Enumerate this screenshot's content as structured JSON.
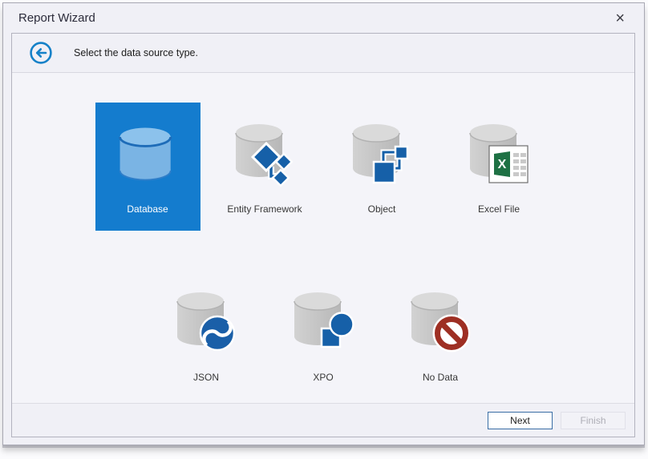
{
  "window": {
    "title": "Report Wizard",
    "close_glyph": "×"
  },
  "header": {
    "instruction": "Select the data source type."
  },
  "tiles": {
    "row1": [
      {
        "label": "Database",
        "icon": "database-cylinder",
        "selected": true
      },
      {
        "label": "Entity Framework",
        "icon": "entity-framework",
        "selected": false
      },
      {
        "label": "Object",
        "icon": "object",
        "selected": false
      },
      {
        "label": "Excel File",
        "icon": "excel-file",
        "selected": false
      }
    ],
    "row2": [
      {
        "label": "JSON",
        "icon": "json-swirl",
        "selected": false
      },
      {
        "label": "XPO",
        "icon": "xpo",
        "selected": false
      },
      {
        "label": "No Data",
        "icon": "no-data",
        "selected": false
      }
    ]
  },
  "footer": {
    "next_label": "Next",
    "finish_label": "Finish",
    "finish_enabled": false
  },
  "colors": {
    "selection_blue": "#147cce",
    "accent_blue": "#1660a8",
    "cylinder_gray": "#c3c3c3",
    "database_light_blue": "#7ab4e4",
    "excel_green": "#1e7144",
    "no_data_red": "#9e2f23",
    "back_arrow_blue": "#1581c8"
  }
}
